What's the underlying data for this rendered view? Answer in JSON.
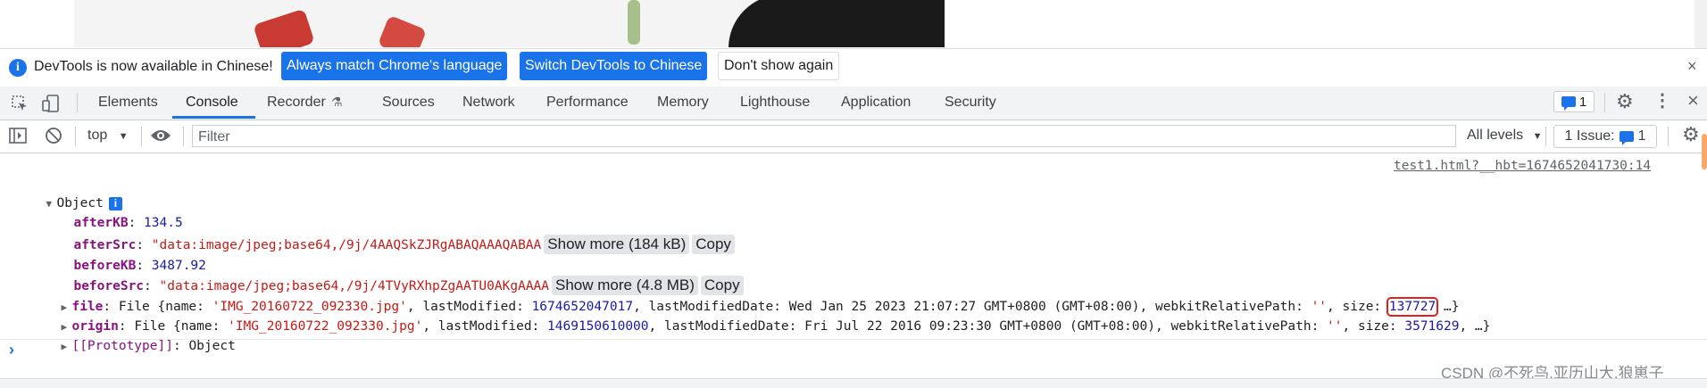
{
  "infobar": {
    "message": "DevTools is now available in Chinese!",
    "btn_match": "Always match Chrome's language",
    "btn_switch": "Switch DevTools to Chinese",
    "btn_dismiss": "Don't show again",
    "close": "×"
  },
  "toolbar": {
    "tabs": [
      "Elements",
      "Console",
      "Recorder",
      "Sources",
      "Network",
      "Performance",
      "Memory",
      "Lighthouse",
      "Application",
      "Security"
    ],
    "active_tab": "Console",
    "issues_count": "1",
    "close": "×"
  },
  "console_toolbar": {
    "context": "top",
    "filter_placeholder": "Filter",
    "levels": "All levels",
    "issues_label": "1 Issue:",
    "issues_count": "1"
  },
  "console": {
    "source_link": "test1.html?__hbt=1674652041730:14",
    "object_label": "Object",
    "rows": {
      "afterKB": {
        "key": "afterKB",
        "value": "134.5"
      },
      "afterSrc": {
        "key": "afterSrc",
        "value": "\"data:image/jpeg;base64,/9j/4AAQSkZJRgABAQAAAQABAA",
        "more": "Show more (184 kB)",
        "copy": "Copy"
      },
      "beforeKB": {
        "key": "beforeKB",
        "value": "3487.92"
      },
      "beforeSrc": {
        "key": "beforeSrc",
        "value": "\"data:image/jpeg;base64,/9j/4TVyRXhpZgAATU0AKgAAAA",
        "more": "Show more (4.8 MB)",
        "copy": "Copy"
      },
      "file": {
        "key": "file",
        "prefix": "File {name: ",
        "name": "'IMG_20160722_092330.jpg'",
        "lm_label": ", lastModified: ",
        "lm": "1674652047017",
        "lmd_label": ", lastModifiedDate: ",
        "lmd": "Wed Jan 25 2023 21:07:27 GMT+0800 (GMT+08:00)",
        "wrp_label": ", webkitRelativePath: ",
        "wrp": "''",
        "size_label": ", size: ",
        "size": "137727",
        "suffix": " …}"
      },
      "origin": {
        "key": "origin",
        "prefix": "File {name: ",
        "name": "'IMG_20160722_092330.jpg'",
        "lm_label": ", lastModified: ",
        "lm": "1469150610000",
        "lmd_label": ", lastModifiedDate: ",
        "lmd": "Fri Jul 22 2016 09:23:30 GMT+0800 (GMT+08:00)",
        "wrp_label": ", webkitRelativePath: ",
        "wrp": "''",
        "size_label": ", size: ",
        "size": "3571629",
        "suffix": ", …}"
      },
      "prototype": {
        "key": "[[Prototype]]",
        "value": "Object"
      }
    }
  },
  "watermark": "CSDN @不死鸟.亚历山大.狼崽子",
  "colors": {
    "accent": "#1a73e8",
    "highlight": "#e31e1e"
  }
}
